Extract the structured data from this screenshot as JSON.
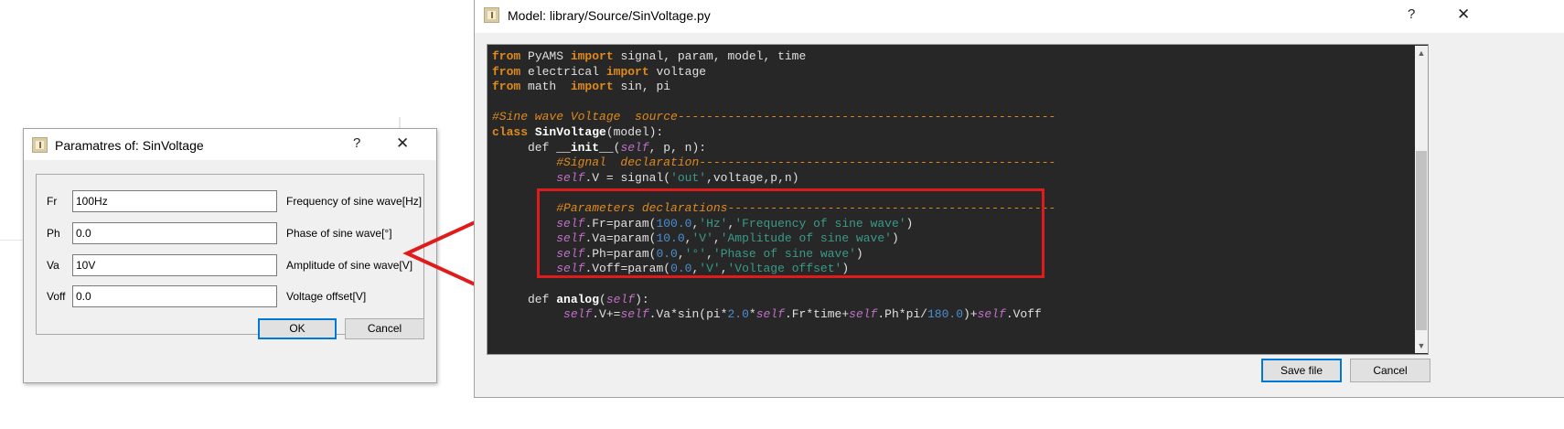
{
  "param_dialog": {
    "title": "Paramatres of:  SinVoltage",
    "help_label": "?",
    "close_label": "✕",
    "rows": [
      {
        "label": "Fr",
        "value": "100Hz",
        "description": "Frequency of sine wave[Hz]"
      },
      {
        "label": "Ph",
        "value": "0.0",
        "description": "Phase of sine wave[°]"
      },
      {
        "label": "Va",
        "value": "10V",
        "description": "Amplitude of sine wave[V]"
      },
      {
        "label": "Voff",
        "value": "0.0",
        "description": "Voltage offset[V]"
      }
    ],
    "ok_label": "OK",
    "cancel_label": "Cancel"
  },
  "model_window": {
    "title": "Model:  library/Source/SinVoltage.py",
    "help_label": "?",
    "close_label": "✕",
    "save_label": "Save file",
    "cancel_label": "Cancel",
    "code": [
      [
        [
          "kw",
          "from"
        ],
        [
          "",
          "PyAMS "
        ],
        [
          "kw",
          "import"
        ],
        [
          "",
          ""
        ],
        [
          "",
          "signal, param, model, time"
        ]
      ],
      [
        [
          "kw",
          "from"
        ],
        [
          "",
          "electrical "
        ],
        [
          "kw",
          "import"
        ],
        [
          "",
          ""
        ],
        [
          "",
          "voltage"
        ]
      ],
      [
        [
          "kw",
          "from"
        ],
        [
          "",
          "math  "
        ],
        [
          "kw",
          "import"
        ],
        [
          "",
          ""
        ],
        [
          "",
          "sin, pi"
        ]
      ],
      [
        [
          "",
          ""
        ]
      ],
      [
        [
          "cm",
          "#Sine wave Voltage  source-----------------------------------------------------"
        ]
      ],
      [
        [
          "kw",
          "class"
        ],
        [
          "",
          ""
        ],
        [
          "df",
          "SinVoltage"
        ],
        [
          "",
          "(model):"
        ]
      ],
      [
        [
          "",
          "     def "
        ],
        [
          "df",
          "__init__"
        ],
        [
          "",
          "("
        ],
        [
          "sf",
          "self"
        ],
        [
          "",
          ", p, n):"
        ]
      ],
      [
        [
          "",
          "         "
        ],
        [
          "cm",
          "#Signal  declaration--------------------------------------------------"
        ]
      ],
      [
        [
          "",
          "         "
        ],
        [
          "sf",
          "self"
        ],
        [
          "",
          ".V = signal("
        ],
        [
          "st",
          "'out'"
        ],
        [
          "",
          ",voltage,p,n)"
        ]
      ],
      [
        [
          "",
          ""
        ]
      ],
      [
        [
          "",
          "         "
        ],
        [
          "cm",
          "#Parameters declarations----------------------------------------------"
        ]
      ],
      [
        [
          "",
          "         "
        ],
        [
          "sf",
          "self"
        ],
        [
          "",
          ".Fr=param("
        ],
        [
          "nm",
          "100.0"
        ],
        [
          "",
          ","
        ],
        [
          "st",
          "'Hz'"
        ],
        [
          "",
          ","
        ],
        [
          "st",
          "'Frequency of sine wave'"
        ],
        [
          "",
          ")"
        ]
      ],
      [
        [
          "",
          "         "
        ],
        [
          "sf",
          "self"
        ],
        [
          "",
          ".Va=param("
        ],
        [
          "nm",
          "10.0"
        ],
        [
          "",
          ","
        ],
        [
          "st",
          "'V'"
        ],
        [
          "",
          ","
        ],
        [
          "st",
          "'Amplitude of sine wave'"
        ],
        [
          "",
          ")"
        ]
      ],
      [
        [
          "",
          "         "
        ],
        [
          "sf",
          "self"
        ],
        [
          "",
          ".Ph=param("
        ],
        [
          "nm",
          "0.0"
        ],
        [
          "",
          ","
        ],
        [
          "st",
          "'°'"
        ],
        [
          "",
          ","
        ],
        [
          "st",
          "'Phase of sine wave'"
        ],
        [
          "",
          ")"
        ]
      ],
      [
        [
          "",
          "         "
        ],
        [
          "sf",
          "self"
        ],
        [
          "",
          ".Voff=param("
        ],
        [
          "nm",
          "0.0"
        ],
        [
          "",
          ","
        ],
        [
          "st",
          "'V'"
        ],
        [
          "",
          ","
        ],
        [
          "st",
          "'Voltage offset'"
        ],
        [
          "",
          ")"
        ]
      ],
      [
        [
          "",
          ""
        ]
      ],
      [
        [
          "",
          "     def "
        ],
        [
          "df",
          "analog"
        ],
        [
          "",
          "("
        ],
        [
          "sf",
          "self"
        ],
        [
          "",
          "):"
        ]
      ],
      [
        [
          "",
          "          "
        ],
        [
          "sf",
          "self"
        ],
        [
          "",
          ".V+="
        ],
        [
          "sf",
          "self"
        ],
        [
          "",
          ".Va*sin(pi*"
        ],
        [
          "nm",
          "2.0"
        ],
        [
          "",
          "*"
        ],
        [
          "sf",
          "self"
        ],
        [
          "",
          ".Fr*time+"
        ],
        [
          "sf",
          "self"
        ],
        [
          "",
          ".Ph*pi/"
        ],
        [
          "nm",
          "180.0"
        ],
        [
          "",
          ")+"
        ],
        [
          "sf",
          "self"
        ],
        [
          "",
          ".Voff"
        ]
      ]
    ]
  },
  "colors": {
    "editor_bg": "#272727",
    "keyword": "#e08a1e",
    "string": "#3a9a8a",
    "number": "#4c8fd0",
    "self": "#c070c8",
    "highlight_box": "#e01b1b",
    "arrow": "#e01b1b",
    "default_button_border": "#0078d7"
  }
}
